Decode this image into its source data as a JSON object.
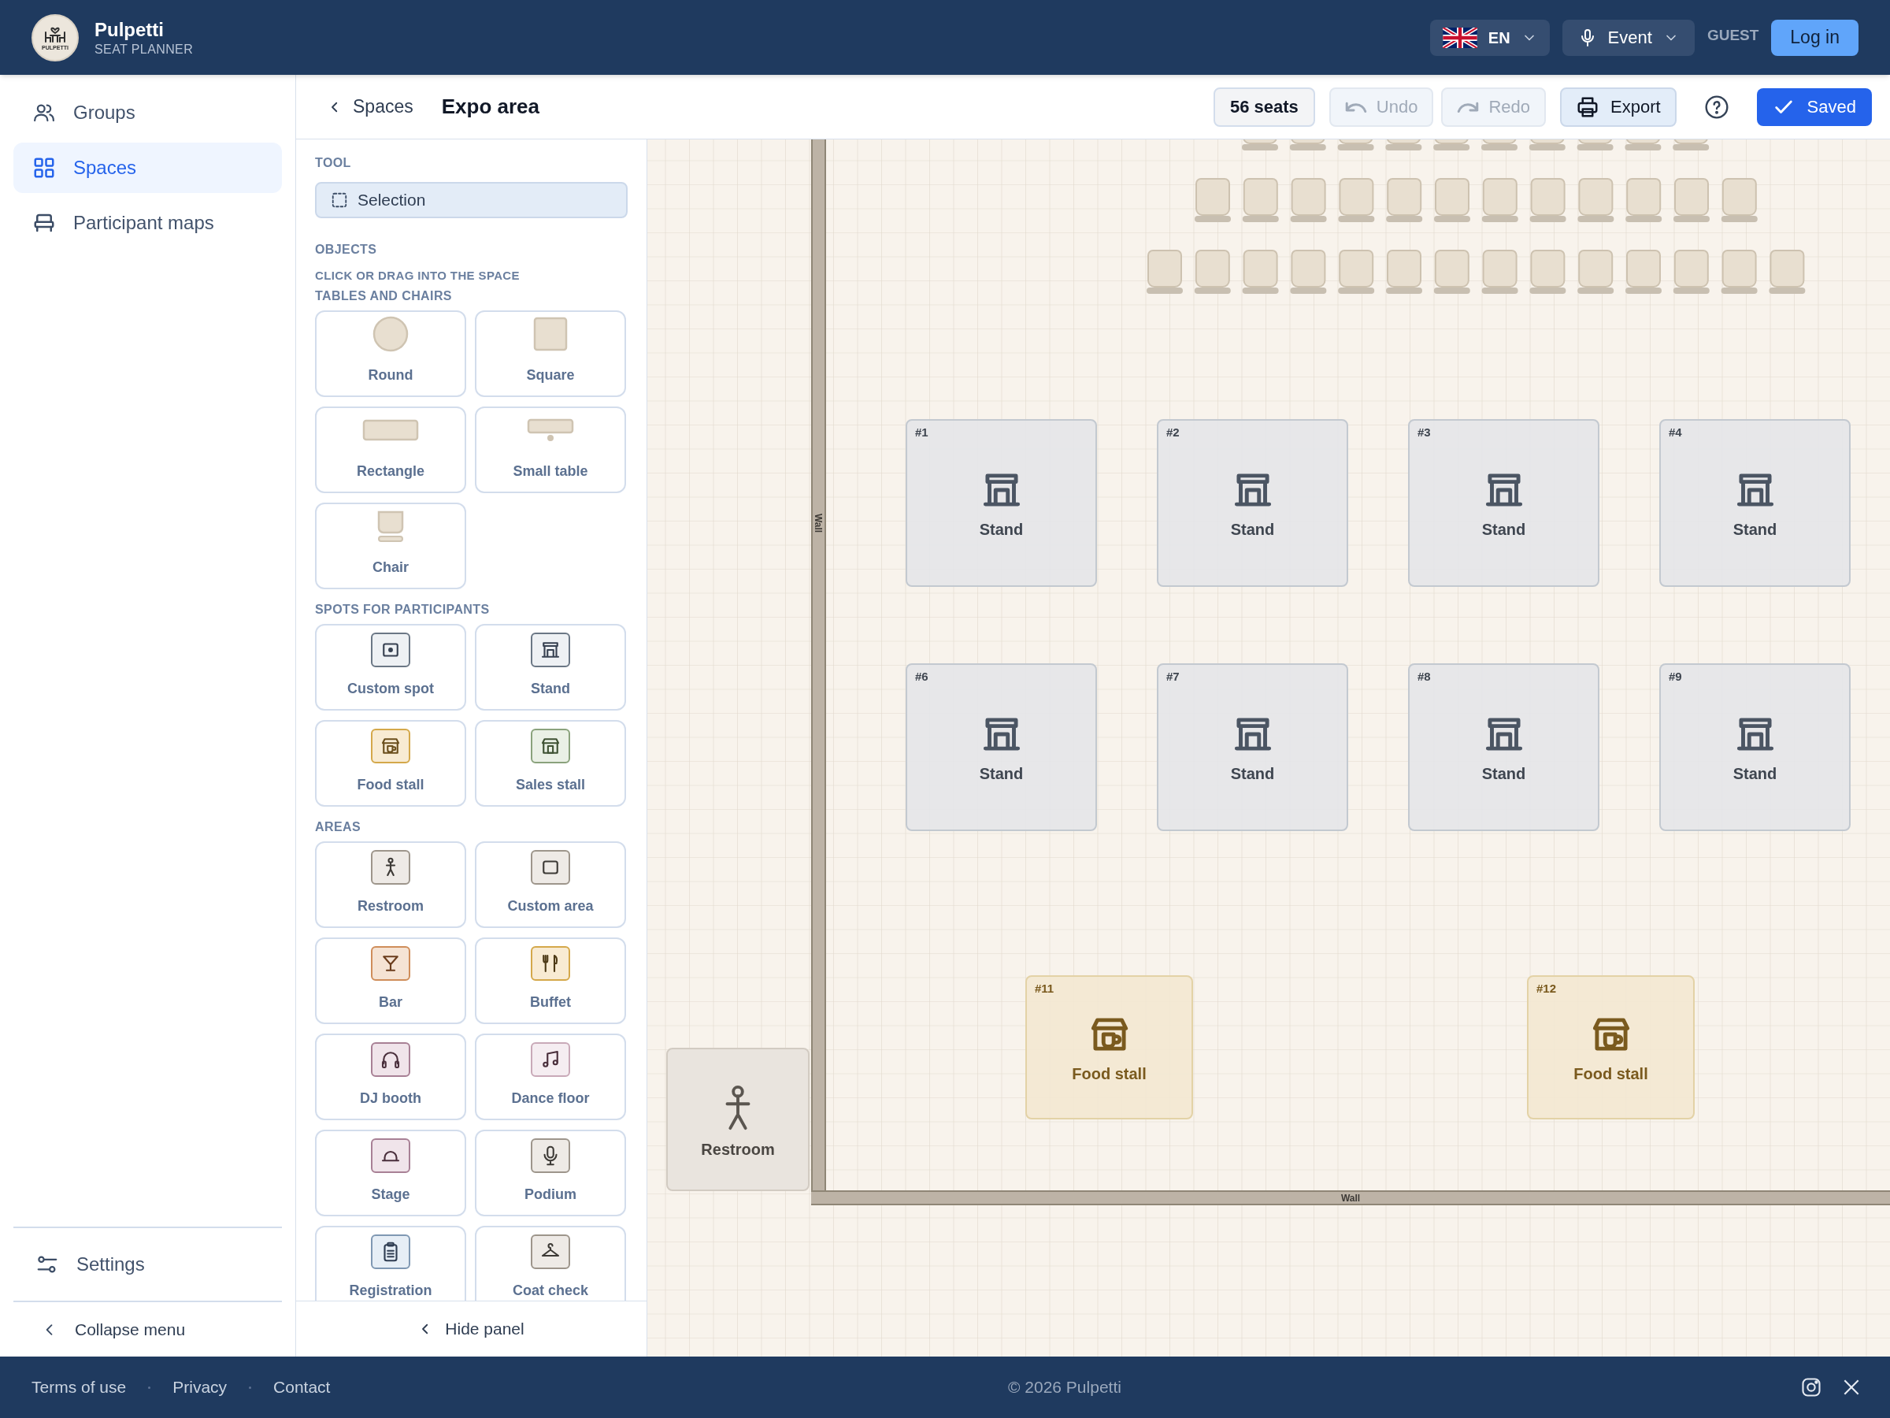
{
  "app": {
    "name": "Pulpetti",
    "subtitle": "SEAT PLANNER",
    "logo_text": "PULPETTI"
  },
  "header": {
    "language": "EN",
    "mode": "Event",
    "user": "GUEST",
    "login": "Log in"
  },
  "sidebar": {
    "items": [
      {
        "label": "Groups",
        "kind": "groups",
        "selected": false
      },
      {
        "label": "Spaces",
        "kind": "spaces",
        "selected": true
      },
      {
        "label": "Participant maps",
        "kind": "maps",
        "selected": false
      }
    ],
    "settings": "Settings",
    "collapse": "Collapse menu"
  },
  "toolbar": {
    "breadcrumb": "Spaces",
    "title": "Expo area",
    "seats": "56 seats",
    "undo": {
      "label": "Undo",
      "disabled": true
    },
    "redo": {
      "label": "Redo",
      "disabled": true
    },
    "export": "Export",
    "save": "Saved"
  },
  "panel": {
    "tool_heading": "TOOL",
    "tool": "Selection",
    "objects_heading": "OBJECTS",
    "hint": "CLICK OR DRAG INTO THE SPACE",
    "groups": [
      {
        "title": "TABLES AND CHAIRS",
        "items": [
          {
            "label": "Round",
            "kind": "round"
          },
          {
            "label": "Square",
            "kind": "square"
          },
          {
            "label": "Rectangle",
            "kind": "rectangle"
          },
          {
            "label": "Small table",
            "kind": "small_table"
          },
          {
            "label": "Chair",
            "kind": "chair"
          }
        ]
      },
      {
        "title": "SPOTS FOR PARTICIPANTS",
        "items": [
          {
            "label": "Custom spot",
            "kind": "custom_spot"
          },
          {
            "label": "Stand",
            "kind": "stand"
          },
          {
            "label": "Food stall",
            "kind": "food_stall"
          },
          {
            "label": "Sales stall",
            "kind": "sales_stall"
          }
        ]
      },
      {
        "title": "AREAS",
        "items": [
          {
            "label": "Restroom",
            "kind": "restroom"
          },
          {
            "label": "Custom area",
            "kind": "custom_area"
          },
          {
            "label": "Bar",
            "kind": "bar"
          },
          {
            "label": "Buffet",
            "kind": "buffet"
          },
          {
            "label": "DJ booth",
            "kind": "dj_booth"
          },
          {
            "label": "Dance floor",
            "kind": "dance_floor"
          },
          {
            "label": "Stage",
            "kind": "stage"
          },
          {
            "label": "Podium",
            "kind": "podium"
          },
          {
            "label": "Registration",
            "kind": "registration"
          },
          {
            "label": "Coat check",
            "kind": "coat_check"
          }
        ]
      }
    ],
    "hide": "Hide panel"
  },
  "canvas": {
    "walls": [
      {
        "label": "Wall",
        "kind": "vertical"
      },
      {
        "label": "Wall",
        "kind": "horizontal"
      }
    ],
    "spots": [
      {
        "number": "#1",
        "label": "Stand",
        "kind": "stand"
      },
      {
        "number": "#2",
        "label": "Stand",
        "kind": "stand"
      },
      {
        "number": "#3",
        "label": "Stand",
        "kind": "stand"
      },
      {
        "number": "#4",
        "label": "Stand",
        "kind": "stand"
      },
      {
        "number": "#6",
        "label": "Stand",
        "kind": "stand"
      },
      {
        "number": "#7",
        "label": "Stand",
        "kind": "stand"
      },
      {
        "number": "#8",
        "label": "Stand",
        "kind": "stand"
      },
      {
        "number": "#9",
        "label": "Stand",
        "kind": "stand"
      },
      {
        "number": "#11",
        "label": "Food stall",
        "kind": "food_stall"
      },
      {
        "number": "#12",
        "label": "Food stall",
        "kind": "food_stall"
      }
    ],
    "areas": [
      {
        "label": "Restroom",
        "kind": "restroom"
      }
    ]
  },
  "footer": {
    "links": [
      "Terms of use",
      "Privacy",
      "Contact"
    ],
    "copyright": "© 2026 Pulpetti"
  }
}
